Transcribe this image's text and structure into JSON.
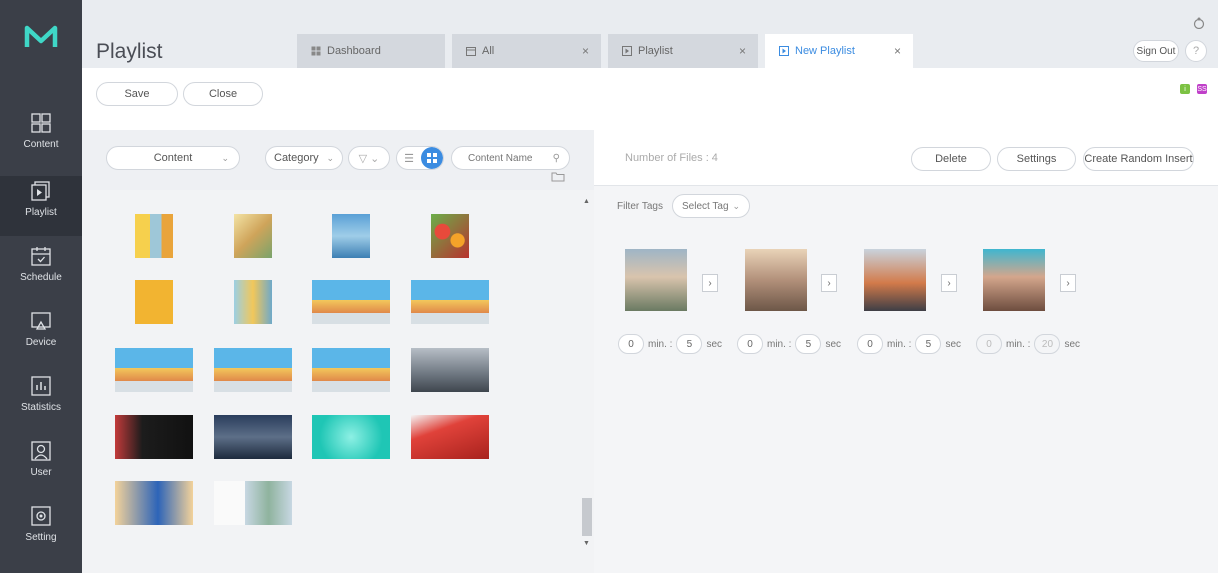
{
  "page": {
    "title": "Playlist"
  },
  "sidebar": {
    "items": [
      {
        "label": "Content",
        "icon": "content-icon"
      },
      {
        "label": "Playlist",
        "icon": "playlist-icon"
      },
      {
        "label": "Schedule",
        "icon": "schedule-icon"
      },
      {
        "label": "Device",
        "icon": "device-icon"
      },
      {
        "label": "Statistics",
        "icon": "statistics-icon"
      },
      {
        "label": "User",
        "icon": "user-icon"
      },
      {
        "label": "Setting",
        "icon": "setting-icon"
      }
    ],
    "active": "Playlist"
  },
  "tabs": [
    {
      "label": "Dashboard",
      "closable": false,
      "icon": "dashboard-icon"
    },
    {
      "label": "All",
      "closable": true,
      "close": "×",
      "icon": "calendar-icon"
    },
    {
      "label": "Playlist",
      "closable": true,
      "close": "×",
      "icon": "playlist-icon"
    },
    {
      "label": "New Playlist",
      "closable": true,
      "close": "×",
      "icon": "playlist-icon",
      "active": true
    }
  ],
  "header": {
    "sign_out": "Sign Out",
    "help": "?"
  },
  "toolbar": {
    "save": "Save",
    "close": "Close"
  },
  "badges": [
    {
      "text": "i",
      "color": "#7cc243"
    },
    {
      "text": "SS",
      "color": "#c040c9"
    }
  ],
  "content_panel": {
    "content_select": "Content",
    "category_select": "Category",
    "search_placeholder": "Content Name"
  },
  "playlist_panel": {
    "files_label": "Number of Files : 4",
    "delete": "Delete",
    "settings": "Settings",
    "random_insert": "Create Random Insert",
    "filter_label": "Filter Tags",
    "tag_select": "Select Tag",
    "items": [
      {
        "min": "0",
        "sec": "5",
        "editable": true
      },
      {
        "min": "0",
        "sec": "5",
        "editable": true
      },
      {
        "min": "0",
        "sec": "5",
        "editable": true
      },
      {
        "min": "0",
        "sec": "20",
        "editable": false
      }
    ],
    "min_label": "min. :",
    "sec_label": "sec"
  },
  "colors": {
    "sidebar": "#3b3f48",
    "accent": "#3b8ce1",
    "logo": "#3fd7c7"
  }
}
